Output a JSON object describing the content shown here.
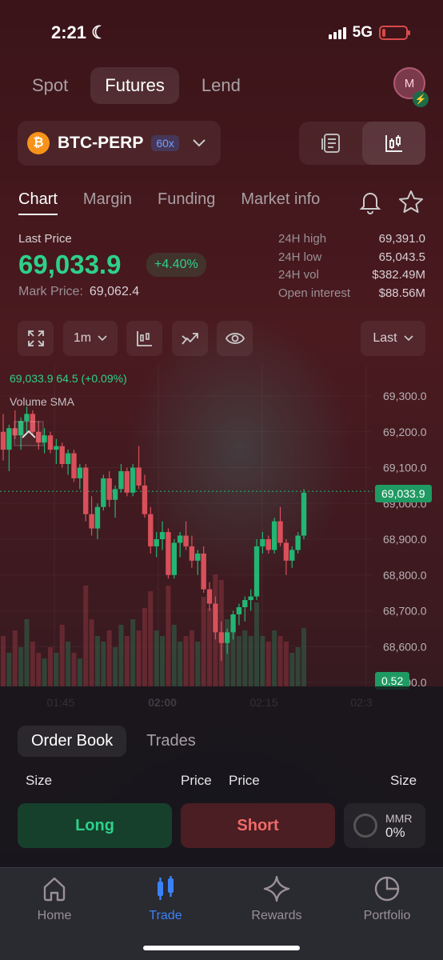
{
  "status": {
    "time": "2:21",
    "network": "5G"
  },
  "top_tabs": [
    {
      "label": "Spot",
      "active": false
    },
    {
      "label": "Futures",
      "active": true
    },
    {
      "label": "Lend",
      "active": false
    }
  ],
  "avatar": {
    "initial": "M"
  },
  "market": {
    "symbol": "BTC-PERP",
    "leverage": "60x",
    "coin_glyph": "₿"
  },
  "section_tabs": [
    {
      "label": "Chart",
      "active": true
    },
    {
      "label": "Margin",
      "active": false
    },
    {
      "label": "Funding",
      "active": false
    },
    {
      "label": "Market info",
      "active": false
    }
  ],
  "price": {
    "last_label": "Last Price",
    "last": "69,033.9",
    "change": "+4.40%",
    "mark_label": "Mark Price:",
    "mark": "69,062.4"
  },
  "stats": [
    {
      "key": "24H high",
      "value": "69,391.0"
    },
    {
      "key": "24H low",
      "value": "65,043.5"
    },
    {
      "key": "24H vol",
      "value": "$382.49M"
    },
    {
      "key": "Open interest",
      "value": "$88.56M"
    }
  ],
  "chart_toolbar": {
    "interval": "1m",
    "price_type": "Last"
  },
  "chart_legend": {
    "ohlc": "69,033.9  64.5 (+0.09%)",
    "volume": "Volume SMA"
  },
  "chart_data": {
    "type": "candlestick",
    "y_ticks": [
      "69,300.0",
      "69,200.0",
      "69,100.0",
      "69,000.0",
      "68,900.0",
      "68,800.0",
      "68,700.0",
      "68,600.0",
      "68,500.0"
    ],
    "x_ticks": [
      "01:45",
      "02:00",
      "02:15",
      "02:3"
    ],
    "ylim": [
      68500,
      69300
    ],
    "last_price_tag": "69,033.9",
    "volume_tag": "0.52",
    "colors": {
      "up": "#22b573",
      "down": "#d9505a"
    },
    "candles": [
      [
        69200,
        69250,
        69120,
        69150
      ],
      [
        69150,
        69220,
        69090,
        69210
      ],
      [
        69210,
        69260,
        69180,
        69190
      ],
      [
        69190,
        69240,
        69150,
        69230
      ],
      [
        69230,
        69270,
        69200,
        69250
      ],
      [
        69250,
        69260,
        69190,
        69200
      ],
      [
        69200,
        69230,
        69150,
        69170
      ],
      [
        69170,
        69210,
        69140,
        69190
      ],
      [
        69190,
        69200,
        69140,
        69150
      ],
      [
        69150,
        69180,
        69110,
        69160
      ],
      [
        69160,
        69170,
        69100,
        69110
      ],
      [
        69110,
        69150,
        69080,
        69140
      ],
      [
        69140,
        69150,
        69060,
        69070
      ],
      [
        69070,
        69110,
        69040,
        69100
      ],
      [
        69100,
        69110,
        68950,
        68970
      ],
      [
        68970,
        69020,
        68910,
        68930
      ],
      [
        68930,
        69000,
        68900,
        68990
      ],
      [
        68990,
        69080,
        68980,
        69070
      ],
      [
        69070,
        69090,
        68990,
        69010
      ],
      [
        69010,
        69050,
        68960,
        69040
      ],
      [
        69040,
        69110,
        69030,
        69090
      ],
      [
        69090,
        69100,
        69020,
        69030
      ],
      [
        69030,
        69110,
        69020,
        69100
      ],
      [
        69100,
        69160,
        69040,
        69050
      ],
      [
        69050,
        69080,
        68960,
        68970
      ],
      [
        68970,
        68990,
        68860,
        68880
      ],
      [
        68880,
        68920,
        68850,
        68900
      ],
      [
        68900,
        68950,
        68870,
        68920
      ],
      [
        68920,
        68930,
        68790,
        68800
      ],
      [
        68800,
        68900,
        68790,
        68890
      ],
      [
        68890,
        68920,
        68850,
        68910
      ],
      [
        68910,
        68950,
        68870,
        68880
      ],
      [
        68880,
        68910,
        68820,
        68840
      ],
      [
        68840,
        68870,
        68800,
        68860
      ],
      [
        68860,
        68880,
        68750,
        68760
      ],
      [
        68760,
        68780,
        68700,
        68720
      ],
      [
        68720,
        68740,
        68620,
        68640
      ],
      [
        68640,
        68670,
        68560,
        68610
      ],
      [
        68610,
        68650,
        68580,
        68640
      ],
      [
        68640,
        68700,
        68620,
        68690
      ],
      [
        68690,
        68720,
        68660,
        68710
      ],
      [
        68710,
        68740,
        68670,
        68730
      ],
      [
        68730,
        68760,
        68700,
        68740
      ],
      [
        68740,
        68900,
        68730,
        68880
      ],
      [
        68880,
        68920,
        68860,
        68900
      ],
      [
        68900,
        68910,
        68860,
        68870
      ],
      [
        68870,
        68960,
        68860,
        68950
      ],
      [
        68950,
        68990,
        68880,
        68890
      ],
      [
        68890,
        68900,
        68800,
        68840
      ],
      [
        68840,
        68880,
        68820,
        68870
      ],
      [
        68870,
        68920,
        68860,
        68910
      ],
      [
        68910,
        69040,
        68900,
        69030
      ]
    ],
    "volumes": [
      0.45,
      0.3,
      0.5,
      0.35,
      0.6,
      0.4,
      0.3,
      0.25,
      0.35,
      0.3,
      0.55,
      0.4,
      0.3,
      0.25,
      0.9,
      0.6,
      0.45,
      0.4,
      0.5,
      0.35,
      0.55,
      0.45,
      0.6,
      0.5,
      0.7,
      0.85,
      0.5,
      0.45,
      0.9,
      0.55,
      0.4,
      0.45,
      0.5,
      0.4,
      0.8,
      0.7,
      1.0,
      0.95,
      0.6,
      0.55,
      0.45,
      0.5,
      0.45,
      0.75,
      0.45,
      0.4,
      0.5,
      0.45,
      0.4,
      0.3,
      0.35,
      0.52
    ]
  },
  "order_book": {
    "tabs": [
      {
        "label": "Order Book",
        "active": true
      },
      {
        "label": "Trades",
        "active": false
      }
    ],
    "head": {
      "size_left": "Size",
      "price_left": "Price",
      "price_right": "Price",
      "size_right": "Size"
    }
  },
  "actions": {
    "long": "Long",
    "short": "Short",
    "mmr_label": "MMR",
    "mmr_value": "0%"
  },
  "nav": [
    {
      "label": "Home",
      "active": false
    },
    {
      "label": "Trade",
      "active": true
    },
    {
      "label": "Rewards",
      "active": false
    },
    {
      "label": "Portfolio",
      "active": false
    }
  ]
}
